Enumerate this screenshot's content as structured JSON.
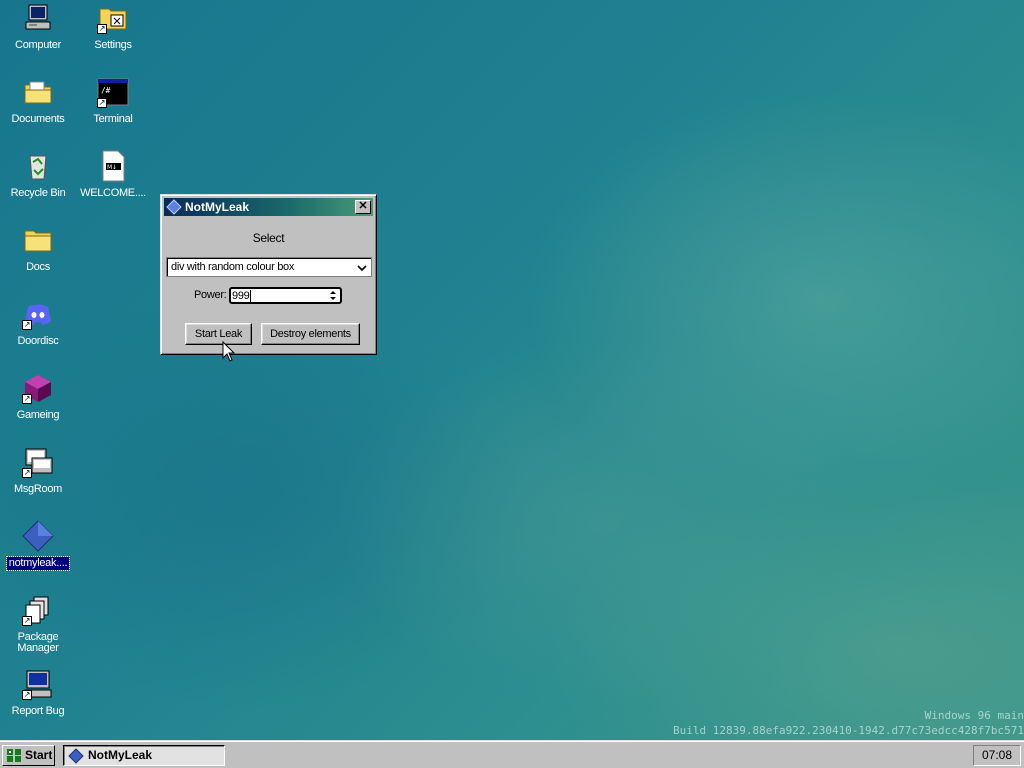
{
  "desktop": {
    "icons": [
      {
        "label": "Computer",
        "icon": "computer-icon"
      },
      {
        "label": "Settings",
        "icon": "settings-icon"
      },
      {
        "label": "Documents",
        "icon": "documents-folder-icon"
      },
      {
        "label": "Terminal",
        "icon": "terminal-icon"
      },
      {
        "label": "Recycle Bin",
        "icon": "recycle-bin-icon"
      },
      {
        "label": "WELCOME....",
        "icon": "markdown-file-icon"
      },
      {
        "label": "Docs",
        "icon": "folder-icon"
      },
      {
        "label": "Doordisc",
        "icon": "discord-icon"
      },
      {
        "label": "Gameing",
        "icon": "game-cube-icon"
      },
      {
        "label": "MsgRoom",
        "icon": "msgroom-icon"
      },
      {
        "label": "notmyleak....",
        "icon": "notmyleak-diamond-icon"
      },
      {
        "label": "Package Manager",
        "icon": "package-manager-icon"
      },
      {
        "label": "Report Bug",
        "icon": "report-bug-icon"
      }
    ]
  },
  "window": {
    "title": "NotMyLeak",
    "close_glyph": "✕",
    "select_label": "Select",
    "dropdown_value": "div with random colour box",
    "power_label": "Power:",
    "power_value": "999",
    "start_button": "Start Leak",
    "destroy_button": "Destroy elements"
  },
  "watermark": {
    "line1": "Windows 96 main",
    "line2": "Build 12839.88efa922.230410-1942.d77c73edcc428f7bc571"
  },
  "taskbar": {
    "start_label": "Start",
    "task_label": "NotMyLeak",
    "clock": "07:08"
  },
  "colors": {
    "window_gray": "#c0c0c0",
    "selection_blue": "#000080",
    "titlebar_start": "#0a2a5a",
    "titlebar_end": "#4a9a7a"
  }
}
